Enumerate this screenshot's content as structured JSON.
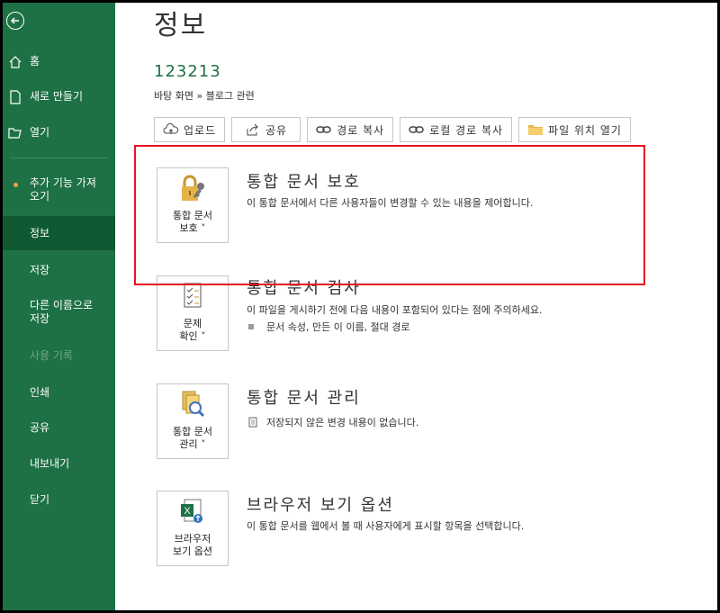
{
  "sidebar": {
    "items": [
      {
        "label": "홈",
        "icon": "home-icon"
      },
      {
        "label": "새로 만들기",
        "icon": "new-document-icon"
      },
      {
        "label": "열기",
        "icon": "open-folder-icon"
      },
      {
        "label": "추가 기능 가져오기"
      },
      {
        "label": "정보"
      },
      {
        "label": "저장"
      },
      {
        "label": "다른 이름으로 저장"
      },
      {
        "label": "사용 기록"
      },
      {
        "label": "인쇄"
      },
      {
        "label": "공유"
      },
      {
        "label": "내보내기"
      },
      {
        "label": "닫기"
      }
    ],
    "addin_line1": "추가 기능 가져",
    "addin_line2": "오기",
    "saveas_line1": "다른 이름으로",
    "saveas_line2": "저장"
  },
  "page": {
    "title": "정보",
    "doc_name": "123213",
    "doc_path": "바탕 화면 » 블로그 관련"
  },
  "toolbar": {
    "upload": "업로드",
    "share": "공유",
    "copy_path": "경로 복사",
    "copy_local_path": "로컬 경로 복사",
    "open_location": "파일 위치 열기"
  },
  "sections": {
    "protect": {
      "button_line1": "통합 문서",
      "button_line2": "보호 ˅",
      "title": "통합 문서 보호",
      "desc": "이 통합 문서에서 다른 사용자들이 변경할 수 있는 내용을 제어합니다."
    },
    "inspect": {
      "button_line1": "문제",
      "button_line2": "확인 ˅",
      "title": "통합 문서 검사",
      "desc": "이 파일을 게시하기 전에 다음 내용이 포함되어 있다는 점에 주의하세요.",
      "sub": "문서 속성, 만든 이 이름, 절대 경로"
    },
    "manage": {
      "button_line1": "통합 문서",
      "button_line2": "관리 ˅",
      "title": "통합 문서 관리",
      "sub": "저장되지 않은 변경 내용이 없습니다."
    },
    "browser": {
      "button_line1": "브라우저",
      "button_line2": "보기 옵션",
      "title": "브라우저 보기 옵션",
      "desc": "이 통합 문서를 웹에서 볼 때 사용자에게 표시할 항목을 선택합니다."
    }
  },
  "colors": {
    "sidebar": "#1e7145",
    "sidebar_selected": "#0f5a32",
    "highlight": "#e81123",
    "accent_text": "#1e7145"
  }
}
